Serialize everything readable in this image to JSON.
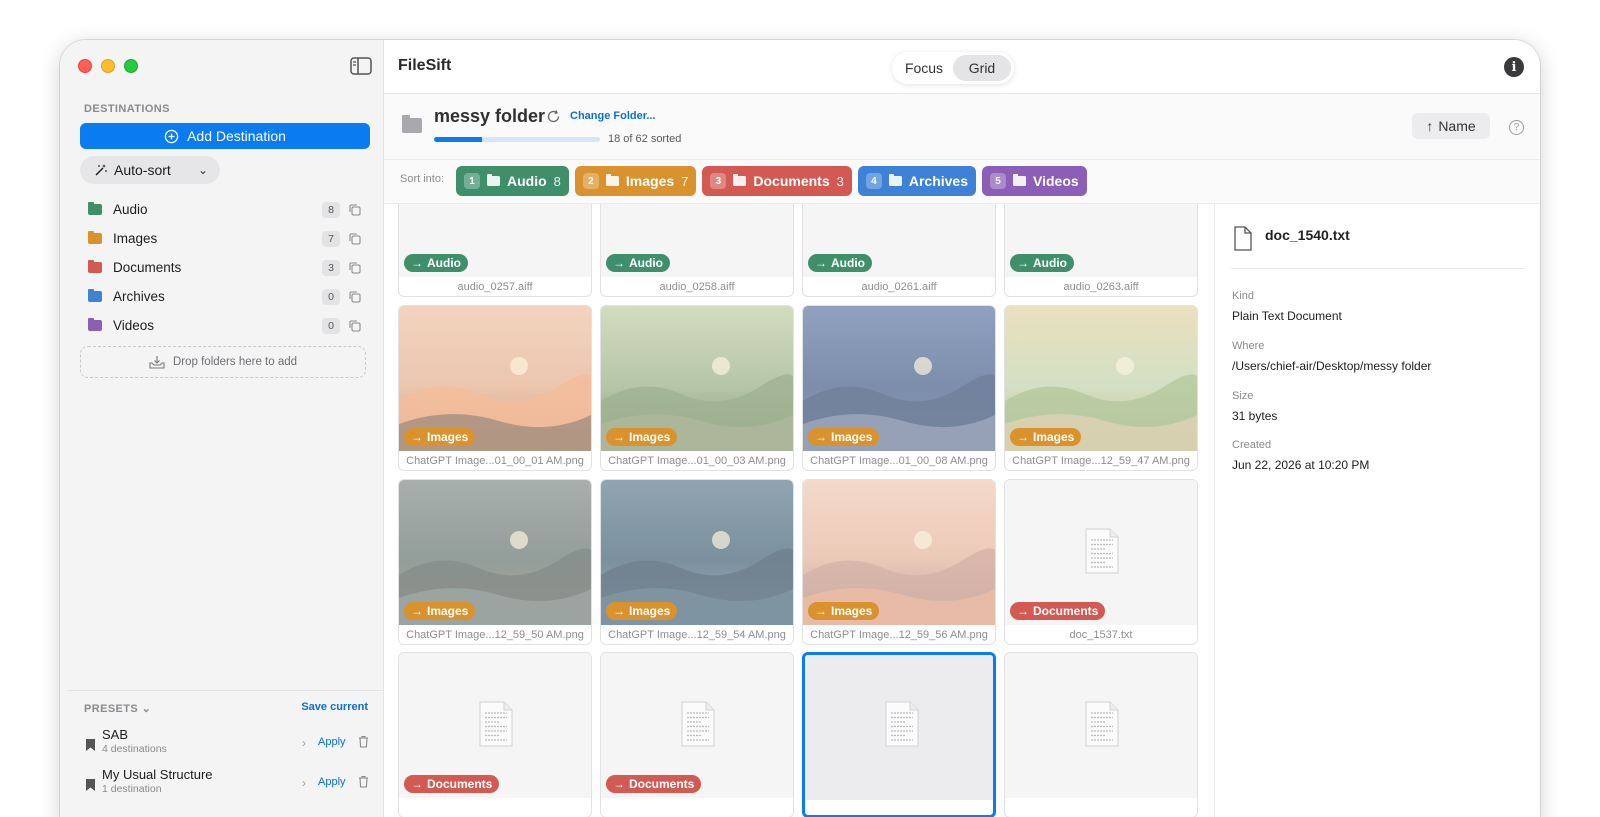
{
  "app": {
    "title": "FileSift"
  },
  "view_modes": {
    "focus": "Focus",
    "grid": "Grid",
    "selected": "Grid"
  },
  "sidebar": {
    "destinations_label": "DESTINATIONS",
    "add_destination": "Add Destination",
    "autosort": "Auto-sort",
    "destinations": [
      {
        "name": "Audio",
        "count": "8",
        "color": "#3f8f6a"
      },
      {
        "name": "Images",
        "count": "7",
        "color": "#d9922e"
      },
      {
        "name": "Documents",
        "count": "3",
        "color": "#d25a52"
      },
      {
        "name": "Archives",
        "count": "0",
        "color": "#3d82d6"
      },
      {
        "name": "Videos",
        "count": "0",
        "color": "#8b5fb8"
      }
    ],
    "drop_hint": "Drop folders here to add",
    "presets_label": "PRESETS",
    "save_current": "Save current",
    "presets": [
      {
        "name": "SAB",
        "sub": "4 destinations",
        "apply": "Apply"
      },
      {
        "name": "My Usual Structure",
        "sub": "1 destination",
        "apply": "Apply"
      }
    ]
  },
  "folder": {
    "name": "messy folder",
    "change": "Change Folder...",
    "sorted_text": "18 of 62 sorted",
    "progress_fraction": 0.29,
    "sort_button": "Name"
  },
  "sortbar": {
    "label": "Sort into:",
    "chips": [
      {
        "key": "1",
        "name": "Audio",
        "count": "8",
        "color": "#3f8f6a"
      },
      {
        "key": "2",
        "name": "Images",
        "count": "7",
        "color": "#d9922e"
      },
      {
        "key": "3",
        "name": "Documents",
        "count": "3",
        "color": "#d25a52"
      },
      {
        "key": "4",
        "name": "Archives",
        "count": "",
        "color": "#3d82d6"
      },
      {
        "key": "5",
        "name": "Videos",
        "count": "",
        "color": "#8b5fb8"
      }
    ]
  },
  "grid": {
    "files": [
      {
        "name": "audio_0257.aiff",
        "tag": "Audio",
        "kind": "audio"
      },
      {
        "name": "audio_0258.aiff",
        "tag": "Audio",
        "kind": "audio"
      },
      {
        "name": "audio_0261.aiff",
        "tag": "Audio",
        "kind": "audio"
      },
      {
        "name": "audio_0263.aiff",
        "tag": "Audio",
        "kind": "audio"
      },
      {
        "name": "ChatGPT Image...01_00_01 AM.png",
        "tag": "Images",
        "kind": "sunset"
      },
      {
        "name": "ChatGPT Image...01_00_03 AM.png",
        "tag": "Images",
        "kind": "forest"
      },
      {
        "name": "ChatGPT Image...01_00_08 AM.png",
        "tag": "Images",
        "kind": "night"
      },
      {
        "name": "ChatGPT Image...12_59_47 AM.png",
        "tag": "Images",
        "kind": "countryside"
      },
      {
        "name": "ChatGPT Image...12_59_50 AM.png",
        "tag": "Images",
        "kind": "village"
      },
      {
        "name": "ChatGPT Image...12_59_54 AM.png",
        "tag": "Images",
        "kind": "bamboo"
      },
      {
        "name": "ChatGPT Image...12_59_56 AM.png",
        "tag": "Images",
        "kind": "lighthouse"
      },
      {
        "name": "doc_1537.txt",
        "tag": "Documents",
        "kind": "doc"
      },
      {
        "name": "",
        "tag": "Documents",
        "kind": "doc"
      },
      {
        "name": "",
        "tag": "Documents",
        "kind": "doc"
      },
      {
        "name": "",
        "tag": "",
        "kind": "doc",
        "selected": true
      },
      {
        "name": "",
        "tag": "",
        "kind": "doc"
      }
    ],
    "tag_colors": {
      "Audio": "#3f8f6a",
      "Images": "#d9922e",
      "Documents": "#d25a52"
    }
  },
  "inspector": {
    "name": "doc_1540.txt",
    "fields": [
      {
        "key": "Kind",
        "value": "Plain Text Document"
      },
      {
        "key": "Where",
        "value": "/Users/chief-air/Desktop/messy folder"
      },
      {
        "key": "Size",
        "value": "31 bytes"
      },
      {
        "key": "Created",
        "value": "Jun 22, 2026 at 10:20 PM"
      }
    ]
  }
}
